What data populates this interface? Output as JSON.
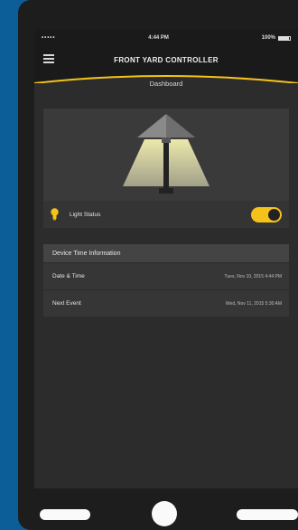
{
  "status_bar": {
    "carrier": "•••••",
    "time": "4:44 PM",
    "battery": "100%"
  },
  "nav": {
    "title": "FRONT YARD CONTROLLER"
  },
  "page": {
    "subtitle": "Dashboard"
  },
  "light": {
    "label": "Light Status",
    "on": true
  },
  "device_time": {
    "header": "Device Time Information",
    "rows": [
      {
        "label": "Date & Time",
        "value": "Tues, Nov 10, 2015 4:44 PM"
      },
      {
        "label": "Next Event",
        "value": "Wed, Nov 11, 2015 5:30 AM"
      }
    ]
  },
  "colors": {
    "accent": "#f4c21a",
    "background": "#0b5e98",
    "panel": "#3a3a3a"
  },
  "icons": [
    "menu-icon",
    "lamp-post-icon",
    "bulb-icon",
    "toggle-switch"
  ]
}
